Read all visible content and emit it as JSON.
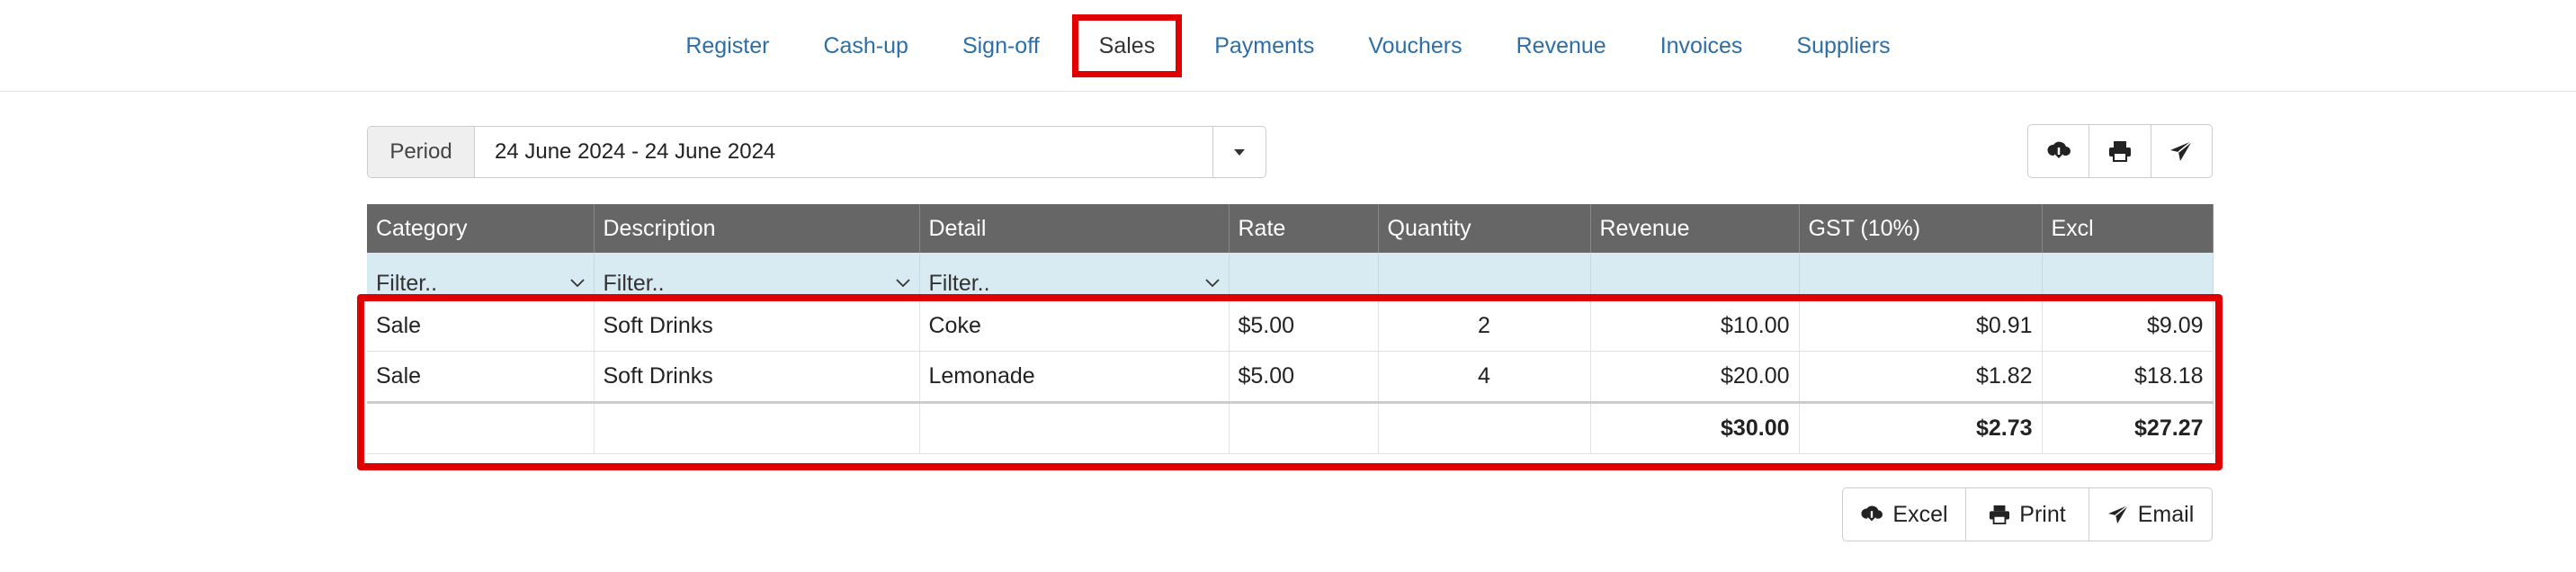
{
  "nav": {
    "items": [
      {
        "label": "Register"
      },
      {
        "label": "Cash-up"
      },
      {
        "label": "Sign-off"
      },
      {
        "label": "Sales",
        "active": true
      },
      {
        "label": "Payments"
      },
      {
        "label": "Vouchers"
      },
      {
        "label": "Revenue"
      },
      {
        "label": "Invoices"
      },
      {
        "label": "Suppliers"
      }
    ]
  },
  "period": {
    "label": "Period",
    "value": "24 June 2024 - 24 June 2024"
  },
  "toolbar_icons": [
    "cloud-download-icon",
    "print-icon",
    "send-icon"
  ],
  "table": {
    "headers": [
      "Category",
      "Description",
      "Detail",
      "Rate",
      "Quantity",
      "Revenue",
      "GST (10%)",
      "Excl"
    ],
    "filter_placeholder": "Filter..",
    "rows": [
      [
        "Sale",
        "Soft Drinks",
        "Coke",
        "$5.00",
        "2",
        "$10.00",
        "$0.91",
        "$9.09"
      ],
      [
        "Sale",
        "Soft Drinks",
        "Lemonade",
        "$5.00",
        "4",
        "$20.00",
        "$1.82",
        "$18.18"
      ]
    ],
    "totals": {
      "revenue": "$30.00",
      "gst": "$2.73",
      "excl": "$27.27"
    }
  },
  "export": {
    "excel_label": "Excel",
    "print_label": "Print",
    "email_label": "Email"
  },
  "colors": {
    "highlight": "#e00000",
    "nav_link": "#2e6ea6",
    "header_bg": "#666666",
    "filter_bg": "#d8eaf2"
  }
}
